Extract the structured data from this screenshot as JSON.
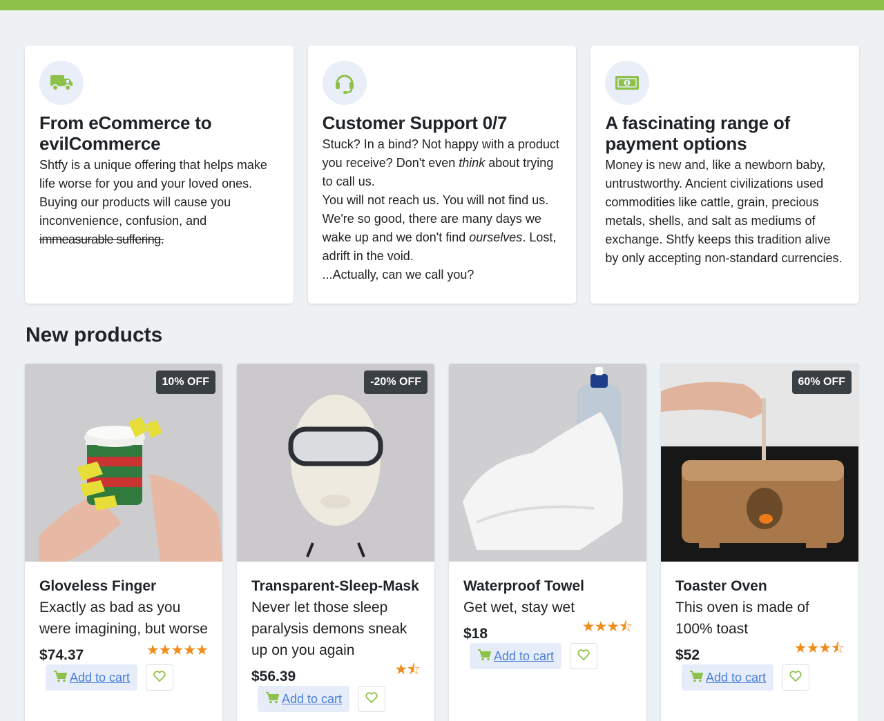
{
  "colors": {
    "accent": "#8dc14a",
    "star": "#f08c1a",
    "link": "#4a7fd6"
  },
  "features": [
    {
      "icon": "truck-icon",
      "title": "From eCommerce to evilCommerce",
      "text_main": "Shtfy is a unique offering that helps make life worse for you and your loved ones. Buying our products will cause you inconvenience, confusion, and",
      "text_garbled": "immeasurable suffering."
    },
    {
      "icon": "headset-icon",
      "title": "Customer Support 0/7",
      "p1_a": "Stuck? In a bind? Not happy with a product you receive? Don't even ",
      "p1_em": "think",
      "p1_b": " about trying to call us.",
      "p2_a": "You will not reach us. You will not find us. We're so good, there are many days we wake up and we don't find ",
      "p2_em": "ourselves",
      "p2_b": ". Lost, adrift in the void.",
      "p3": "...Actually, can we call you?"
    },
    {
      "icon": "money-icon",
      "title": "A fascinating range of payment options",
      "text": "Money is new and, like a newborn baby, untrustworthy. Ancient civilizations used commodities like cattle, grain, precious metals, shells, and salt as mediums of exchange. Shtfy keeps this tradition alive by only accepting non-standard currencies."
    }
  ],
  "section_title": "New products",
  "products": [
    {
      "name": "Gloveless Finger",
      "desc": "Exactly as bad as you were imagining, but worse",
      "price": "$74.37",
      "badge": "10% OFF",
      "rating": 5,
      "stars": "★★★★★",
      "cart_label": "Add to cart"
    },
    {
      "name": "Transparent-Sleep-Mask",
      "desc": "Never let those sleep paralysis demons sneak up on you again",
      "price": "$56.39",
      "badge": "-20% OFF",
      "rating": 1.5,
      "stars": "★⯪",
      "cart_label": "Add to cart"
    },
    {
      "name": "Waterproof Towel",
      "desc": "Get wet, stay wet",
      "price": "$18",
      "badge": "",
      "rating": 3.5,
      "stars": "★★★⯪",
      "cart_label": "Add to cart"
    },
    {
      "name": "Toaster Oven",
      "desc": "This oven is made of 100% toast",
      "price": "$52",
      "badge": "60% OFF",
      "rating": 3.5,
      "stars": "★★★⯪",
      "cart_label": "Add to cart"
    }
  ]
}
